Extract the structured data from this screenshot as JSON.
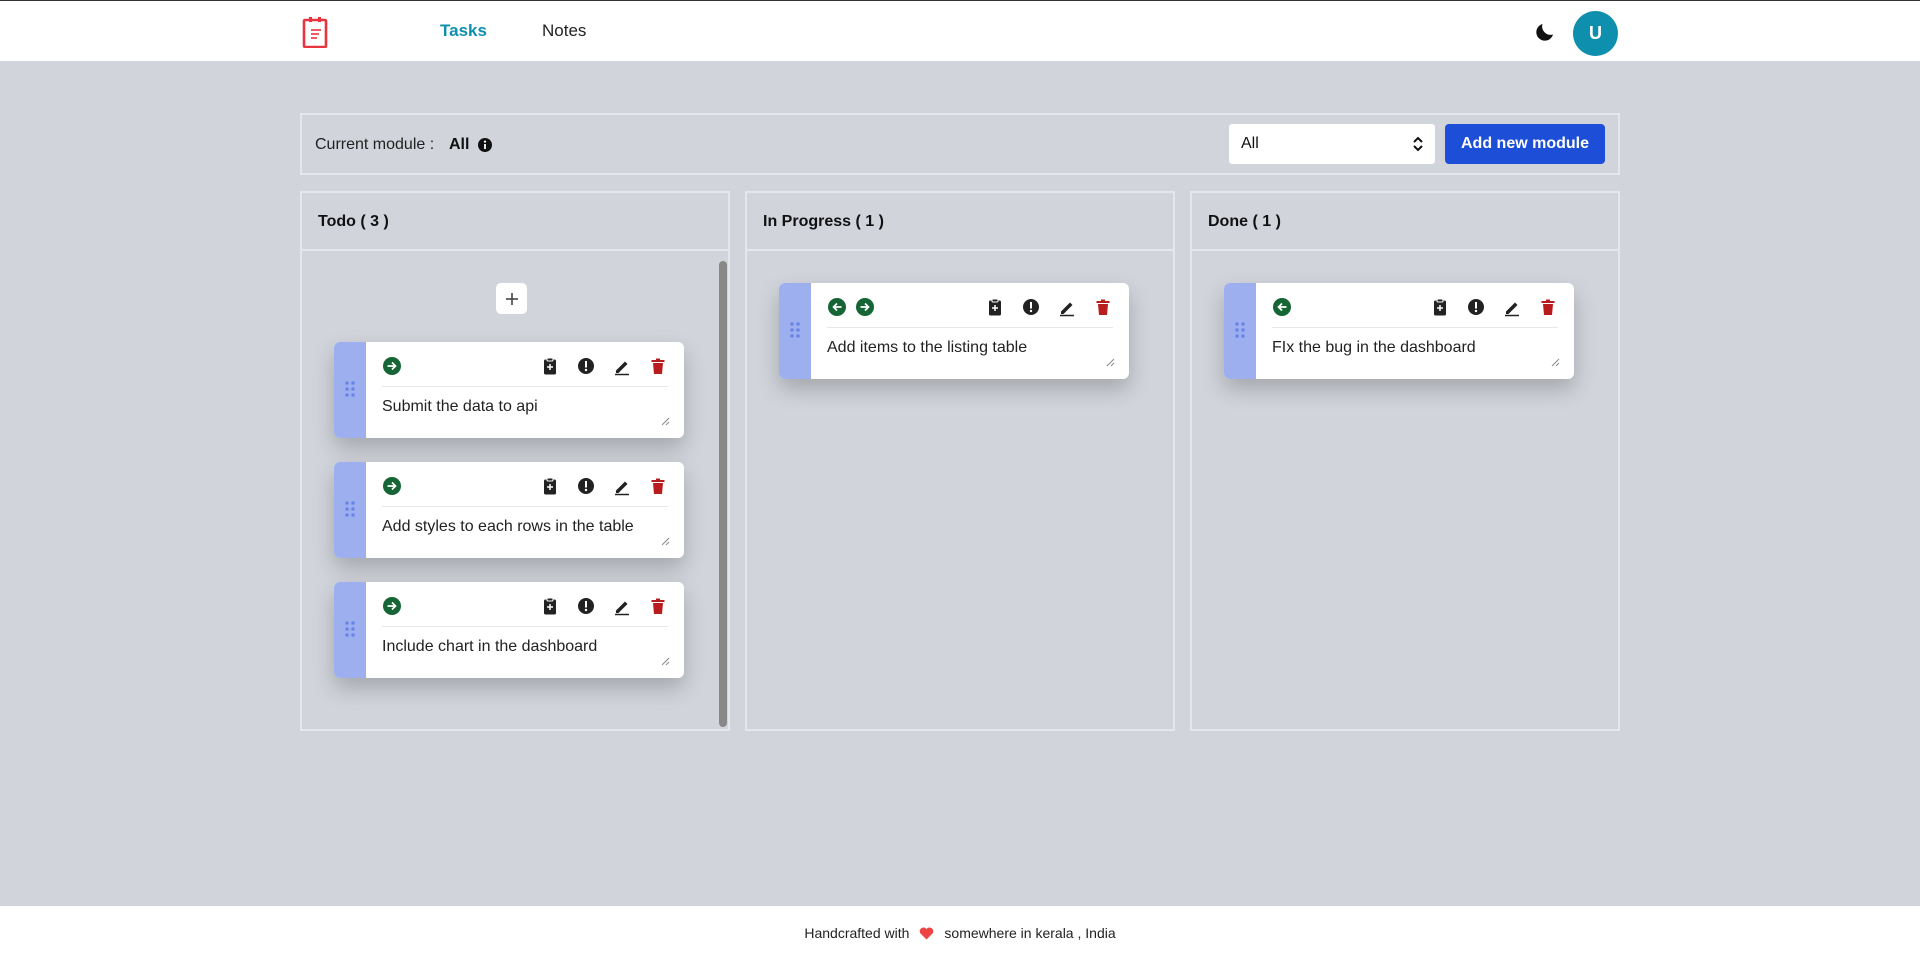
{
  "header": {
    "nav": {
      "tasks": "Tasks",
      "notes": "Notes"
    },
    "avatar_initial": "U",
    "icons": {
      "logo": "notepad-logo",
      "theme": "moon-icon"
    }
  },
  "module_bar": {
    "label": "Current module :",
    "current": "All",
    "select_value": "All",
    "add_button": "Add new module"
  },
  "columns": [
    {
      "title": "Todo ( 3 )",
      "cards": [
        {
          "text": "Submit the data to api",
          "actions": [
            "forward"
          ]
        },
        {
          "text": "Add styles to each rows in the table",
          "actions": [
            "forward"
          ]
        },
        {
          "text": "Include chart in the dashboard",
          "actions": [
            "forward"
          ]
        }
      ]
    },
    {
      "title": "In Progress ( 1 )",
      "cards": [
        {
          "text": "Add items to the listing table",
          "actions": [
            "back",
            "forward"
          ]
        }
      ]
    },
    {
      "title": "Done ( 1 )",
      "cards": [
        {
          "text": "FIx the bug in the dashboard",
          "actions": [
            "back"
          ]
        }
      ]
    }
  ],
  "footer": {
    "before": "Handcrafted with",
    "after": "somewhere in kerala , India"
  },
  "colors": {
    "accent": "#0e8fae",
    "primary_button": "#1d4ed8",
    "move_icon": "#166534",
    "delete_icon": "#b91c1c",
    "drag_handle": "#9eaff0",
    "heart": "#ef4444"
  }
}
